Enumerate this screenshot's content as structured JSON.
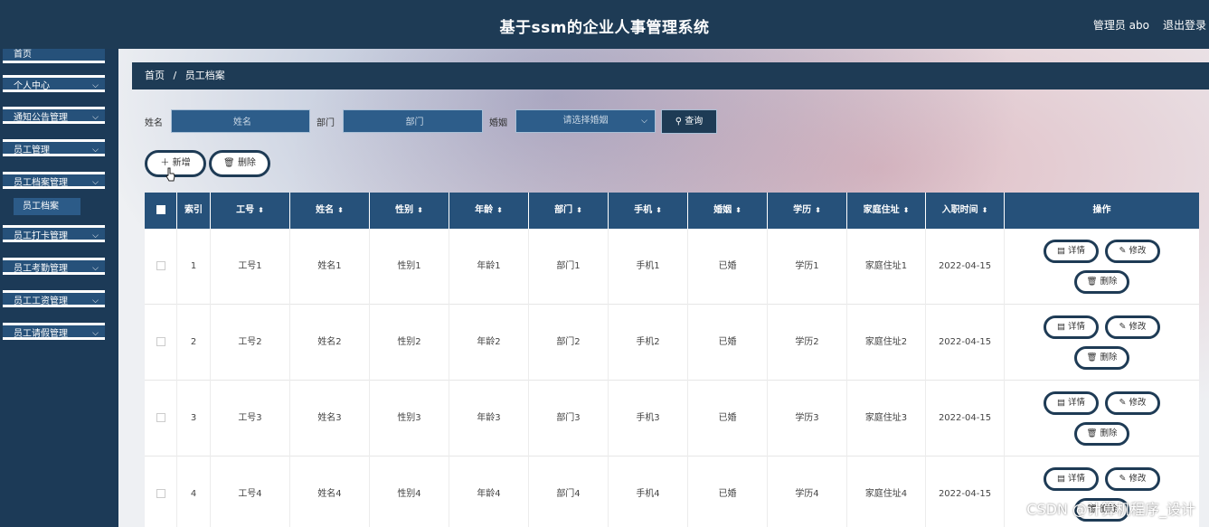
{
  "header": {
    "title": "基于ssm的企业人事管理系统",
    "user": "管理员 abo",
    "logout": "退出登录"
  },
  "sidebar": {
    "items": [
      {
        "label": "首页"
      },
      {
        "label": "个人中心"
      },
      {
        "label": "通知公告管理"
      },
      {
        "label": "员工管理"
      },
      {
        "label": "员工档案管理"
      },
      {
        "label": "员工打卡管理"
      },
      {
        "label": "员工考勤管理"
      },
      {
        "label": "员工工资管理"
      },
      {
        "label": "员工请假管理"
      }
    ],
    "submenu": {
      "label": "员工档案"
    }
  },
  "breadcrumb": {
    "home": "首页",
    "sep": "/",
    "current": "员工档案"
  },
  "search": {
    "name_label": "姓名",
    "name_placeholder": "姓名",
    "dept_label": "部门",
    "dept_placeholder": "部门",
    "marriage_label": "婚姻",
    "marriage_placeholder": "请选择婚姻",
    "query_label": "查询"
  },
  "toolbar": {
    "add_label": "新增",
    "delete_label": "删除"
  },
  "table": {
    "columns": [
      "索引",
      "工号",
      "姓名",
      "性别",
      "年龄",
      "部门",
      "手机",
      "婚姻",
      "学历",
      "家庭住址",
      "入职时间",
      "操作"
    ],
    "rows": [
      {
        "idx": "1",
        "no": "工号1",
        "name": "姓名1",
        "sex": "性别1",
        "age": "年龄1",
        "dept": "部门1",
        "phone": "手机1",
        "marriage": "已婚",
        "edu": "学历1",
        "addr": "家庭住址1",
        "date": "2022-04-15"
      },
      {
        "idx": "2",
        "no": "工号2",
        "name": "姓名2",
        "sex": "性别2",
        "age": "年龄2",
        "dept": "部门2",
        "phone": "手机2",
        "marriage": "已婚",
        "edu": "学历2",
        "addr": "家庭住址2",
        "date": "2022-04-15"
      },
      {
        "idx": "3",
        "no": "工号3",
        "name": "姓名3",
        "sex": "性别3",
        "age": "年龄3",
        "dept": "部门3",
        "phone": "手机3",
        "marriage": "已婚",
        "edu": "学历3",
        "addr": "家庭住址3",
        "date": "2022-04-15"
      },
      {
        "idx": "4",
        "no": "工号4",
        "name": "姓名4",
        "sex": "性别4",
        "age": "年龄4",
        "dept": "部门4",
        "phone": "手机4",
        "marriage": "已婚",
        "edu": "学历4",
        "addr": "家庭住址4",
        "date": "2022-04-15"
      }
    ],
    "actions": {
      "detail": "详情",
      "edit": "修改",
      "delete": "删除"
    }
  },
  "watermark": "CSDN @计算机程序_设计",
  "colors": {
    "header_bg": "#1e3b55",
    "accent": "#26517a",
    "input_bg": "#2d5d8a"
  }
}
